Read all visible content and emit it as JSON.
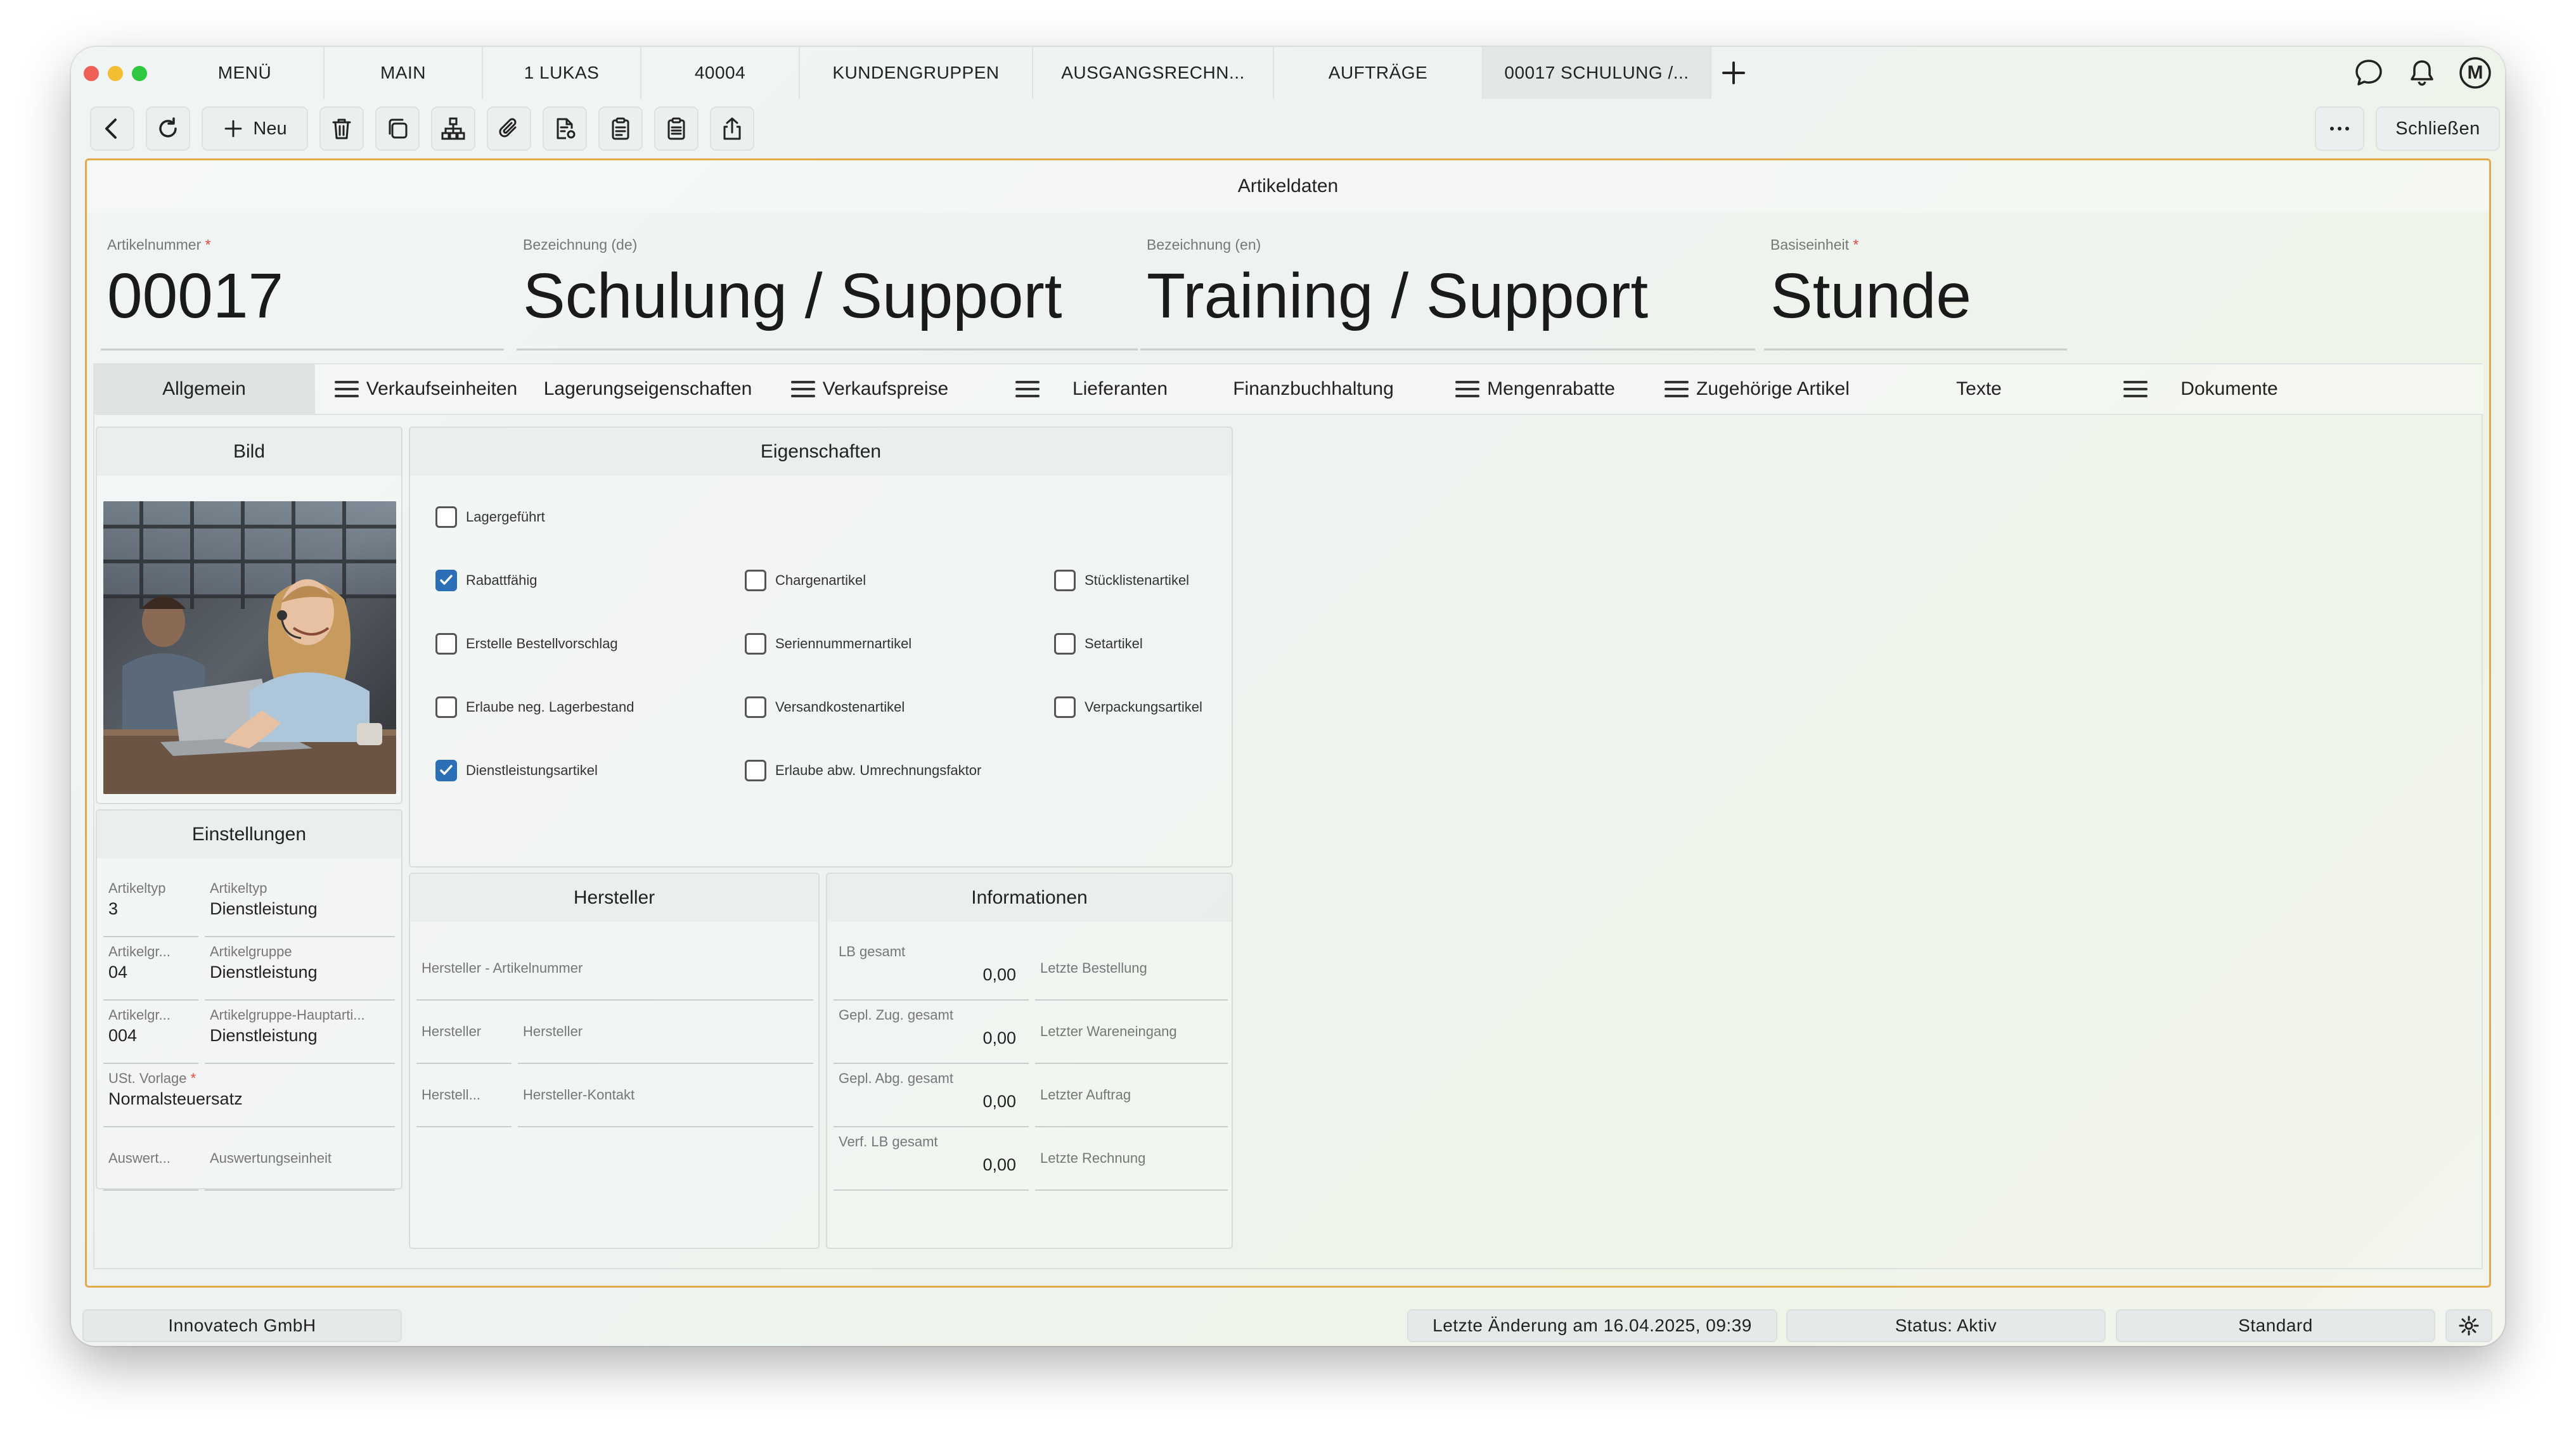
{
  "tabbar": {
    "tabs": [
      "MENÜ",
      "MAIN",
      "1 LUKAS",
      "40004",
      "KUNDENGRUPPEN",
      "AUSGANGSRECHN...",
      "AUFTRÄGE",
      "00017 SCHULUNG /..."
    ],
    "active_index": 7,
    "avatar_letter": "M"
  },
  "toolbar": {
    "new_label": "Neu",
    "close_label": "Schließen"
  },
  "page": {
    "title": "Artikeldaten"
  },
  "header_fields": {
    "article_number": {
      "label": "Artikelnummer",
      "value": "00017"
    },
    "name_de": {
      "label": "Bezeichnung (de)",
      "value": "Schulung / Support"
    },
    "name_en": {
      "label": "Bezeichnung (en)",
      "value": "Training / Support"
    },
    "base_unit": {
      "label": "Basiseinheit",
      "value": "Stunde"
    }
  },
  "section_tabs": [
    {
      "label": "Allgemein"
    },
    {
      "label": "Verkaufseinheiten"
    },
    {
      "label": "Lagerungseigenschaften"
    },
    {
      "label": "Verkaufspreise"
    },
    {
      "label": "Lieferanten"
    },
    {
      "label": "Finanzbuchhaltung"
    },
    {
      "label": "Mengenrabatte"
    },
    {
      "label": "Zugehörige Artikel"
    },
    {
      "label": "Texte"
    },
    {
      "label": "Dokumente"
    }
  ],
  "panels": {
    "image_title": "Bild",
    "settings_title": "Einstellungen",
    "properties_title": "Eigenschaften",
    "manufacturer_title": "Hersteller",
    "info_title": "Informationen"
  },
  "properties": {
    "lagergefuehrt": "Lagergeführt",
    "rabattfaehig": "Rabattfähig",
    "chargenartikel": "Chargenartikel",
    "stuecklistenartikel": "Stücklistenartikel",
    "bestellvorschlag": "Erstelle Bestellvorschlag",
    "seriennummernartikel": "Seriennummernartikel",
    "setartikel": "Setartikel",
    "neg_lagerbestand": "Erlaube neg. Lagerbestand",
    "versandkostenartikel": "Versandkostenartikel",
    "verpackungsartikel": "Verpackungsartikel",
    "dienstleistungsartikel": "Dienstleistungsartikel",
    "umrechnungsfaktor": "Erlaube abw. Umrechnungsfaktor"
  },
  "settings": {
    "artikeltyp_code_label": "Artikeltyp",
    "artikeltyp_code": "3",
    "artikeltyp_label": "Artikeltyp",
    "artikeltyp": "Dienstleistung",
    "gruppe_code_label": "Artikelgr...",
    "gruppe_code": "04",
    "gruppe_label": "Artikelgruppe",
    "gruppe": "Dienstleistung",
    "hauptgruppe_code_label": "Artikelgr...",
    "hauptgruppe_code": "004",
    "hauptgruppe_label": "Artikelgruppe-Hauptarti...",
    "hauptgruppe": "Dienstleistung",
    "ust_label": "USt. Vorlage",
    "ust": "Normalsteuersatz",
    "auswert_code_label": "Auswert...",
    "auswert_label": "Auswertungseinheit"
  },
  "manufacturer": {
    "artikelnummer_label": "Hersteller - Artikelnummer",
    "code_label": "Hersteller",
    "name_label": "Hersteller",
    "kontakt_code_label": "Herstell...",
    "kontakt_label": "Hersteller-Kontakt"
  },
  "info": {
    "lb_gesamt_label": "LB gesamt",
    "lb_gesamt": "0,00",
    "zug_label": "Gepl. Zug. gesamt",
    "zug": "0,00",
    "abg_label": "Gepl. Abg. gesamt",
    "abg": "0,00",
    "verf_label": "Verf. LB gesamt",
    "verf": "0,00",
    "letzte_bestellung": "Letzte Bestellung",
    "letzter_wareneingang": "Letzter Wareneingang",
    "letzter_auftrag": "Letzter Auftrag",
    "letzte_rechnung": "Letzte Rechnung"
  },
  "statusbar": {
    "company": "Innovatech GmbH",
    "last_change": "Letzte Änderung am 16.04.2025, 09:39",
    "status": "Status: Aktiv",
    "view": "Standard"
  },
  "colors": {
    "accent_border": "#e3a94a",
    "checkbox_on": "#2b6fb6",
    "required": "#e0443e"
  }
}
